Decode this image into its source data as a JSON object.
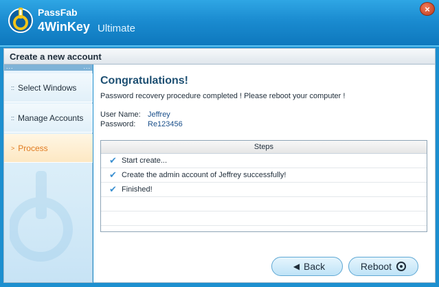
{
  "app": {
    "brand_small": "PassFab",
    "brand_name": "4WinKey",
    "edition": "Ultimate",
    "close_glyph": "×"
  },
  "section": {
    "title": "Create a new account",
    "dots_left": "...",
    "dots_right": "..."
  },
  "sidebar": {
    "items": [
      {
        "label": "Select Windows",
        "bullet": "::",
        "active": false
      },
      {
        "label": "Manage Accounts",
        "bullet": "::",
        "active": false
      },
      {
        "label": "Process",
        "bullet": ">",
        "active": true
      }
    ]
  },
  "main": {
    "heading": "Congratulations!",
    "description": "Password recovery procedure completed ! Please reboot your computer !",
    "username_label": "User Name:",
    "username_value": "Jeffrey",
    "password_label": "Password:",
    "password_value": "Re123456",
    "steps_header": "Steps",
    "steps": [
      "Start create...",
      "Create the admin account of Jeffrey successfully!",
      "Finished!"
    ]
  },
  "buttons": {
    "back_label": "Back",
    "reboot_label": "Reboot"
  },
  "colors": {
    "titlebar": "#1a8bd0",
    "heading": "#1d4f72",
    "active_item": "#e07a1f",
    "check": "#3a8fd0"
  },
  "icons": {
    "logo": "passfab-key-logo-icon",
    "close": "close-icon",
    "check": "check-icon",
    "back": "arrow-left-icon",
    "reboot": "power-icon"
  }
}
